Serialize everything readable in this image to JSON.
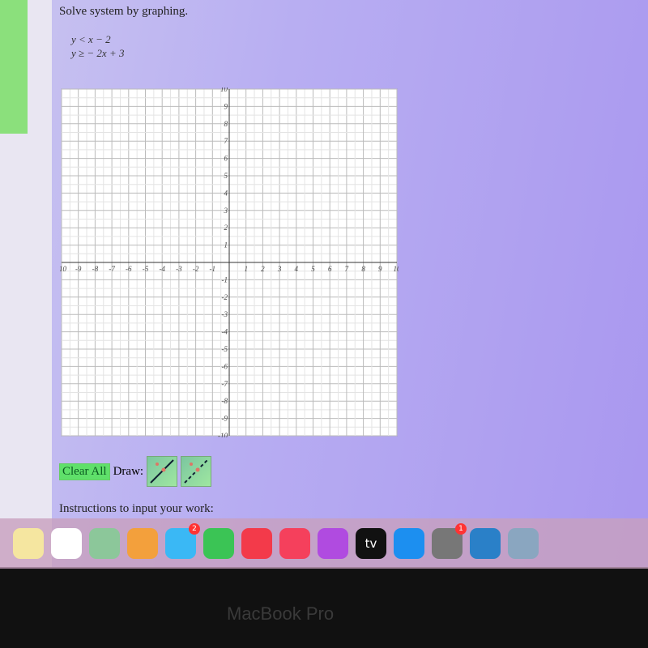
{
  "prompt": "Solve system by graphing.",
  "system": {
    "eq1": "y < x − 2",
    "eq2": "y ≥ − 2x + 3"
  },
  "graph": {
    "xmin": -10,
    "xmax": 10,
    "ymin": -10,
    "ymax": 10,
    "step": 1,
    "grid": true
  },
  "controls": {
    "clear_label": "Clear All",
    "draw_label": "Draw:",
    "tools": [
      "solid-line-tool",
      "dashed-line-tool"
    ]
  },
  "instructions": "Instructions to input your work:",
  "dock": [
    {
      "name": "notes"
    },
    {
      "name": "reminders"
    },
    {
      "name": "maps"
    },
    {
      "name": "photos"
    },
    {
      "name": "messages",
      "badge": "2"
    },
    {
      "name": "facetime"
    },
    {
      "name": "news"
    },
    {
      "name": "music"
    },
    {
      "name": "podcasts"
    },
    {
      "name": "tv",
      "label": "tv"
    },
    {
      "name": "app-store"
    },
    {
      "name": "system-preferences",
      "badge": "1"
    },
    {
      "name": "quicktime"
    },
    {
      "name": "preview"
    }
  ],
  "bezel": "MacBook Pro",
  "colors": {
    "accent": "#5fe06a",
    "background": "#b8aef2"
  }
}
